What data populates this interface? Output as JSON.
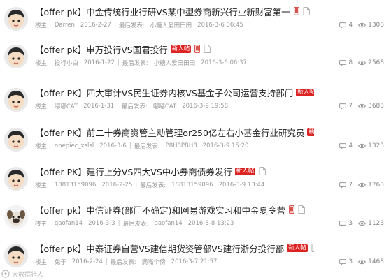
{
  "threads": [
    {
      "title": "【offer pk】中金传统行业行研VS某中型券商新兴行业新财富第一",
      "is_new": false,
      "has_phone": true,
      "has_doc": true,
      "has_chart": false,
      "author_label": "楼主:",
      "author": "Darren",
      "post_date": "2016-2-27",
      "last_label": "最后发表:",
      "last_poster": "小糖人爱田田田",
      "last_time": "2016-3-6 06:45",
      "replies": "4",
      "views": "1308",
      "avatar": "cartoon"
    },
    {
      "title": "【offer pk】申万投行VS国君投行",
      "is_new": true,
      "has_phone": true,
      "has_doc": true,
      "has_chart": false,
      "author_label": "楼主:",
      "author": "投行小白",
      "post_date": "2016-1-22",
      "last_label": "最后发表:",
      "last_poster": "小糖人爱田田田",
      "last_time": "2016-3-6 06:37",
      "replies": "8",
      "views": "2568",
      "avatar": "cartoon"
    },
    {
      "title": "【offer PK】四大审计VS民生证券内核VS基金子公司运营支持部门",
      "is_new": true,
      "has_phone": false,
      "has_doc": false,
      "has_chart": true,
      "author_label": "楼主:",
      "author": "嘟嘟CAT",
      "post_date": "2016-1-31",
      "last_label": "最后发表:",
      "last_poster": "嘟嘟CAT",
      "last_time": "2016-3-9 19:58",
      "replies": "7",
      "views": "3683",
      "avatar": "cartoon"
    },
    {
      "title": "【offer PK】前二十券商资管主动管理or250亿左右小基金行业研究员",
      "is_new": true,
      "has_phone": false,
      "has_doc": true,
      "has_chart": false,
      "author_label": "楼主:",
      "author": "onepiec_xslsl",
      "post_date": "2016-3-6",
      "last_label": "最后发表:",
      "last_poster": "P8H8PBH8",
      "last_time": "2016-3-9 15:20",
      "replies": "4",
      "views": "1323",
      "avatar": "cartoon"
    },
    {
      "title": "【offer PK】建行上分VS四大VS中小券商债券发行",
      "is_new": true,
      "has_phone": false,
      "has_doc": true,
      "has_chart": false,
      "author_label": "楼主:",
      "author": "18813159096",
      "post_date": "2016-2-25",
      "last_label": "最后发表:",
      "last_poster": "18813159096",
      "last_time": "2016-3-9 13:44",
      "replies": "7",
      "views": "1763",
      "avatar": "cartoon"
    },
    {
      "title": "【offer pk】中信证券(部门不确定)和网易游戏实习和中金夏令营",
      "is_new": false,
      "has_phone": true,
      "has_doc": true,
      "has_chart": false,
      "author_label": "楼主:",
      "author": "gaofan14",
      "post_date": "2016-3-3",
      "last_label": "最后发表:",
      "last_poster": "gaofan14",
      "last_time": "2016-3-8 13:23",
      "replies": "3",
      "views": "1123",
      "avatar": "dog"
    },
    {
      "title": "【offer pk】中泰证券自营VS建信期货资管部VS建行浙分投行部",
      "is_new": true,
      "has_phone": false,
      "has_doc": true,
      "has_chart": false,
      "author_label": "楼主:",
      "author": "免子",
      "post_date": "2016-2-24",
      "last_label": "最后发表:",
      "last_poster": "满嘴个傍",
      "last_time": "2016-3-7 21:57",
      "replies": "3",
      "views": "1468",
      "avatar": "cartoon"
    }
  ],
  "labels": {
    "new_badge": "新人帖"
  },
  "watermark": {
    "text": "大数据猎人"
  },
  "colors": {
    "new_badge": "#dd2222",
    "phone_icon": "#d9534f",
    "meta_text": "#999999"
  },
  "icons": {
    "phone": "phone-icon",
    "doc": "doc-icon",
    "chart": "chart-icon",
    "replies": "comment-icon",
    "views": "eye-icon"
  }
}
